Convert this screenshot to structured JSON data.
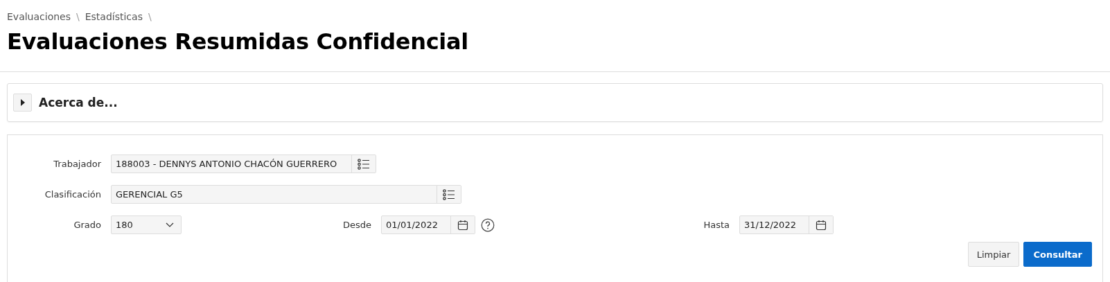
{
  "breadcrumb": [
    {
      "label": "Evaluaciones",
      "separator": "\\"
    },
    {
      "label": "Estadísticas",
      "separator": "\\"
    }
  ],
  "title": "Evaluaciones Resumidas Confidencial",
  "about": {
    "label": "Acerca de...",
    "expanded": false
  },
  "form": {
    "rows": [
      [
        {
          "kind": "lov",
          "label": "Trabajador",
          "value": "188003 - DENNYS ANTONIO CHACÓN GUERRERO"
        }
      ],
      [
        {
          "kind": "lov",
          "label": "Clasificación",
          "value": "GERENCIAL G5"
        }
      ],
      [
        {
          "kind": "select",
          "label": "Grado",
          "value": "180"
        },
        {
          "kind": "date",
          "label": "Desde",
          "value": "01/01/2022",
          "help": true
        },
        {
          "kind": "date",
          "label": "Hasta",
          "value": "31/12/2022",
          "help": false
        }
      ]
    ]
  },
  "buttons": [
    {
      "label": "Limpiar",
      "kind": "secondary"
    },
    {
      "label": "Consultar",
      "kind": "primary"
    }
  ]
}
